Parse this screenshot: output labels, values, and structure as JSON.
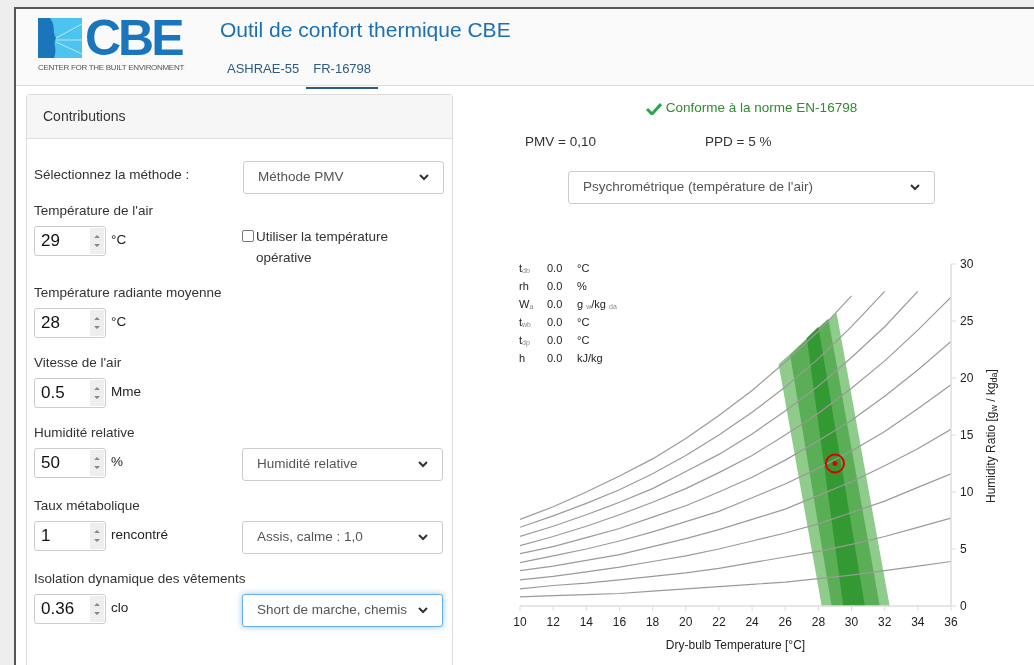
{
  "header": {
    "logo_text": "CBE",
    "logo_subtitle": "CENTER FOR THE BUILT ENVIRONMENT",
    "title": "Outil de confort thermique CBE"
  },
  "tabs": [
    {
      "label": "ASHRAE-55",
      "selected": false
    },
    {
      "label": "FR-16798",
      "selected": true
    }
  ],
  "inputs_panel": {
    "title": "Contributions",
    "method": {
      "label": "Sélectionnez la méthode :",
      "value": "Méthode PMV",
      "focused": false
    },
    "fields": [
      {
        "label": "Température de l'air",
        "value": "29",
        "unit": "°C",
        "checkbox": {
          "label": "Utiliser la température opérative",
          "checked": false
        }
      },
      {
        "label": "Température radiante moyenne",
        "value": "28",
        "unit": "°C"
      },
      {
        "label": "Vitesse de l'air",
        "value": "0.5",
        "unit": "Mme"
      },
      {
        "label": "Humidité relative",
        "value": "50",
        "unit": "%",
        "select": {
          "value": "Humidité relative",
          "focused": false
        }
      },
      {
        "label": "Taux métabolique",
        "value": "1",
        "unit": "rencontré",
        "select": {
          "value": "Assis, calme : 1,0",
          "focused": false
        }
      },
      {
        "label": "Isolation dynamique des vêtements",
        "value": "0.36",
        "unit": "clo",
        "select": {
          "value": "Short de marche, chemis",
          "focused": true
        }
      }
    ]
  },
  "results": {
    "compliant": true,
    "compliance": "Conforme à la norme EN-16798",
    "pmv": "PMV = 0,10",
    "ppd": "PPD = 5 %",
    "chart_select": "Psychrométrique (température de l'air)",
    "readout": [
      {
        "symbol": "t$_{db}$",
        "value": "0.0",
        "unit": "°C"
      },
      {
        "symbol": "rh",
        "value": "0.0",
        "unit": "%"
      },
      {
        "symbol": "W$_{a}$",
        "value": "0.0",
        "unit": "g $_{w}$/kg $_{da}$"
      },
      {
        "symbol": "t$_{wb}$",
        "value": "0.0",
        "unit": "°C"
      },
      {
        "symbol": "t$_{dp}$",
        "value": "0.0",
        "unit": "°C"
      },
      {
        "symbol": "h",
        "value": "0.0",
        "unit": "kJ/kg"
      }
    ],
    "chart_data": {
      "type": "line",
      "xlabel": "Dry-bulb Temperature [°C]",
      "ylabel": "Humidity Ratio [g$_{w}$ / kg$_{da}$]",
      "x": [
        10,
        12,
        14,
        16,
        18,
        20,
        22,
        24,
        26,
        28,
        30,
        32,
        34,
        36
      ],
      "xlim": [
        10,
        36
      ],
      "ylim": [
        0,
        30
      ],
      "xticks": [
        10,
        12,
        14,
        16,
        18,
        20,
        22,
        24,
        26,
        28,
        30,
        32,
        34,
        36
      ],
      "yticks": [
        0,
        5,
        10,
        15,
        20,
        25,
        30
      ],
      "series": [
        {
          "color": "#9a9a9a",
          "values": [
            7.6,
            8.7,
            10.0,
            11.4,
            12.9,
            14.7,
            16.7,
            18.9,
            21.4,
            24.1,
            27.2,
            null,
            null,
            null
          ]
        },
        {
          "color": "#9a9a9a",
          "values": [
            6.9,
            7.9,
            9.0,
            10.2,
            11.6,
            13.2,
            15.0,
            17.0,
            19.2,
            21.7,
            24.5,
            27.6,
            null,
            null
          ]
        },
        {
          "color": "#9a9a9a",
          "values": [
            6.1,
            7.0,
            8.0,
            9.1,
            10.3,
            11.8,
            13.3,
            15.1,
            17.1,
            19.3,
            21.8,
            24.5,
            27.6,
            null
          ]
        },
        {
          "color": "#9a9a9a",
          "values": [
            5.3,
            6.1,
            7.0,
            8.0,
            9.1,
            10.3,
            11.7,
            13.2,
            15.0,
            16.9,
            19.1,
            21.5,
            24.2,
            27.1
          ]
        },
        {
          "color": "#9a9a9a",
          "values": [
            4.6,
            5.2,
            6.0,
            6.8,
            7.8,
            8.8,
            10.0,
            11.3,
            12.8,
            14.5,
            16.3,
            18.4,
            20.7,
            23.2
          ]
        },
        {
          "color": "#9a9a9a",
          "values": [
            3.8,
            4.4,
            5.0,
            5.7,
            6.5,
            7.4,
            8.3,
            9.5,
            10.7,
            12.1,
            13.6,
            15.3,
            17.3,
            19.4
          ]
        },
        {
          "color": "#9a9a9a",
          "values": [
            3.1,
            3.5,
            4.0,
            4.5,
            5.2,
            5.9,
            6.7,
            7.6,
            8.5,
            9.7,
            10.9,
            12.3,
            13.8,
            15.5
          ]
        },
        {
          "color": "#9a9a9a",
          "values": [
            2.3,
            2.6,
            3.0,
            3.4,
            3.9,
            4.4,
            5.0,
            5.7,
            6.4,
            7.2,
            8.2,
            9.2,
            10.4,
            11.6
          ]
        },
        {
          "color": "#9a9a9a",
          "values": [
            1.5,
            1.8,
            2.0,
            2.3,
            2.6,
            2.9,
            3.3,
            3.8,
            4.3,
            4.8,
            5.4,
            6.1,
            6.9,
            7.7
          ]
        },
        {
          "color": "#9a9a9a",
          "values": [
            0.8,
            0.9,
            1.0,
            1.1,
            1.3,
            1.5,
            1.7,
            1.9,
            2.1,
            2.4,
            2.7,
            3.1,
            3.5,
            3.9
          ]
        }
      ]
    }
  }
}
